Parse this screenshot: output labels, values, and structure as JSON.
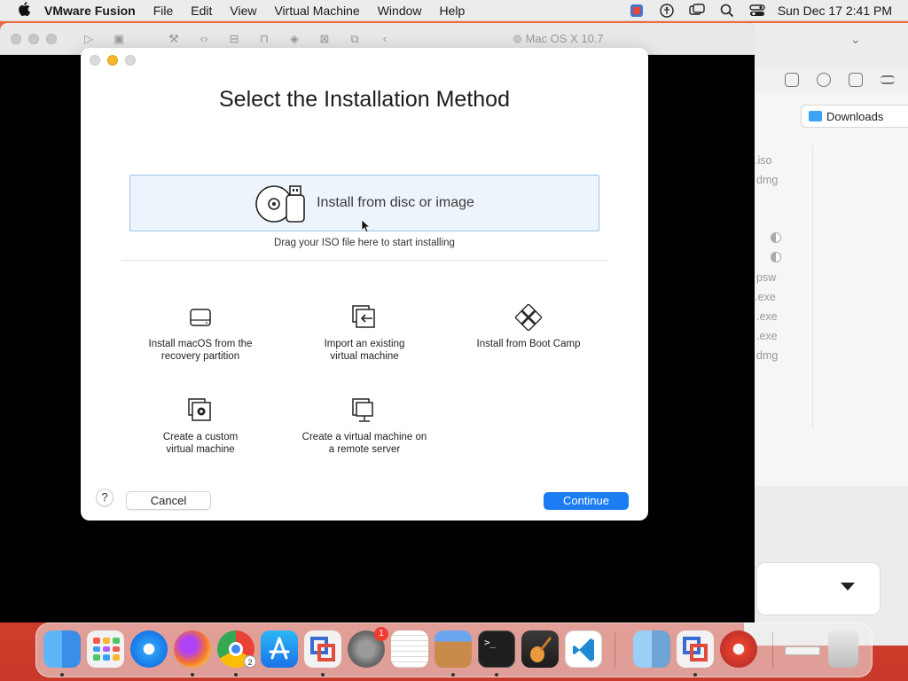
{
  "menubar": {
    "app_name": "VMware Fusion",
    "menus": [
      "File",
      "Edit",
      "View",
      "Virtual Machine",
      "Window",
      "Help"
    ],
    "clock": "Sun Dec 17  2:41 PM"
  },
  "vm_window": {
    "vm_name": "Mac OS X 10.7"
  },
  "finder": {
    "location": "Downloads",
    "files": [
      ".iso",
      "dmg",
      "psw",
      ").exe",
      ".exe",
      ".exe",
      "dmg"
    ]
  },
  "dialog": {
    "title": "Select the Installation Method",
    "dropzone_label": "Install from disc or image",
    "dropzone_hint": "Drag your ISO file here to start installing",
    "options": [
      {
        "label_line1": "Install macOS from the",
        "label_line2": "recovery partition"
      },
      {
        "label_line1": "Import an existing",
        "label_line2": "virtual machine"
      },
      {
        "label_line1": "Install from Boot Camp",
        "label_line2": ""
      },
      {
        "label_line1": "Create a custom",
        "label_line2": "virtual machine"
      },
      {
        "label_line1": "Create a virtual machine on",
        "label_line2": "a remote server"
      }
    ],
    "help_label": "?",
    "cancel_label": "Cancel",
    "continue_label": "Continue"
  },
  "dock": {
    "apps": [
      "finder",
      "launchpad",
      "safari",
      "firefox",
      "chrome",
      "app-store",
      "vmware-fusion",
      "system-settings",
      "textedit",
      "installer",
      "terminal",
      "garageband",
      "vscode",
      "finder-2",
      "vmware-fusion-2",
      "safari-dev",
      "disk",
      "trash"
    ],
    "badges": {
      "system_settings": "1",
      "chrome": "2"
    }
  },
  "colors": {
    "accent": "#1c7cf4",
    "dropzone_bg": "#edf4fb",
    "dropzone_border": "#9cc4ea"
  }
}
